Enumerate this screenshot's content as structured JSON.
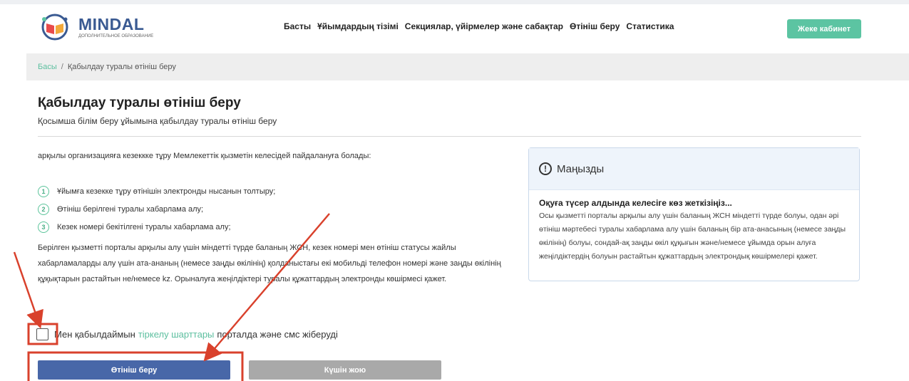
{
  "header": {
    "logo_name": "MINDAL",
    "logo_sub": "ДОПОЛНИТЕЛЬНОЕ ОБРАЗОВАНИЕ",
    "nav": [
      "Басты",
      "Ұйымдардың тізімі",
      "Секциялар, үйірмелер және сабақтар",
      "Өтініш беру",
      "Статистика"
    ],
    "cabinet_label": "Жеке кабинет"
  },
  "breadcrumb": {
    "home": "Басы",
    "separator": "/",
    "current": "Қабылдау туралы өтініш беру"
  },
  "page": {
    "title": "Қабылдау туралы өтініш беру",
    "subtitle": "Қосымша білім беру ұйымына қабылдау туралы өтініш беру",
    "intro": "арқылы организацияға кезеккке тұру Мемлекеттік қызметін келесідей пайдалануға болады:",
    "steps": [
      {
        "num": "1",
        "text": "Ұйымға кезекке тұру өтінішін электронды нысанын толтыру;"
      },
      {
        "num": "2",
        "text": "Өтініш берілгені туралы хабарлама алу;"
      },
      {
        "num": "3",
        "text": "Кезек номері бекітілгені туралы хабарлама алу;"
      }
    ],
    "description": "Берілген қызметті порталы арқылы алу үшін міндетті түрде баланың ЖСН, кезек номері мен өтініш статусы жайлы хабарламаларды алу үшін ата-ананың (немесе заңды өкілінің) қолданыстағы екі мобильді телефон номері және заңды өкілінің құқықтарын растайтын не/немесе kz. Орыналуға жеңілдіктері туралы құжаттардың электронды көшірмесі қажет."
  },
  "card": {
    "title": "Маңызды",
    "subtitle": "Оқуға түсер алдында келесіге көз жеткізіңіз...",
    "body": "Осы қызметті порталы арқылы алу үшін баланың ЖСН міндетті түрде болуы, одан әрі өтініш мәртебесі туралы хабарлама алу үшін баланың бір ата-анасының (немесе заңды өкілінің) болуы, сондай-ақ заңды өкіл құқығын және/немесе ұйымда орын алуға жеңілдіктердің болуын растайтын құжаттардың электрондық көшірмелері қажет."
  },
  "consent": {
    "prefix": "Мен қабылдаймын",
    "link": "тіркелу шарттары",
    "suffix": "порталда және смс жіберуді",
    "checked": false
  },
  "buttons": {
    "submit": "Өтініш беру",
    "cancel": "Күшін жою"
  },
  "colors": {
    "accent_green": "#5cc4a2",
    "primary_blue": "#4867a8",
    "annotation_red": "#d9412c"
  }
}
